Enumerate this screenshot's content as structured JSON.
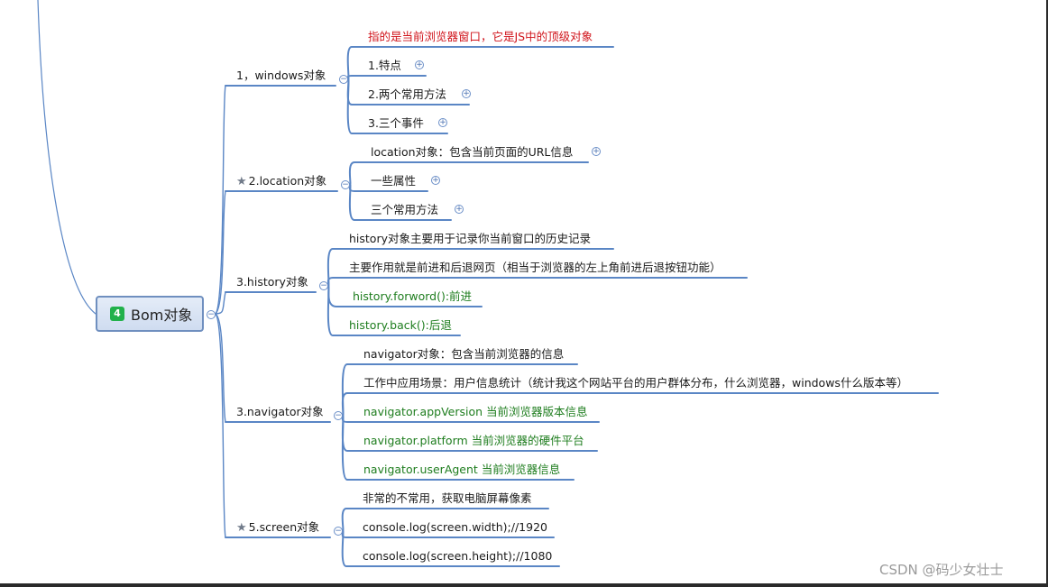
{
  "root": {
    "badge": "4",
    "label": "Bom对象"
  },
  "branches": [
    {
      "label": "1，windows对象",
      "starred": false,
      "toggle": "−",
      "children": [
        {
          "text": "指的是当前浏览器窗口，它是JS中的顶级对象",
          "color": "red",
          "toggle": ""
        },
        {
          "text": "1.特点",
          "color": "black",
          "toggle": "+"
        },
        {
          "text": "2.两个常用方法",
          "color": "black",
          "toggle": "+"
        },
        {
          "text": "3.三个事件",
          "color": "black",
          "toggle": "+"
        }
      ]
    },
    {
      "label": "2.location对象",
      "starred": true,
      "toggle": "−",
      "children": [
        {
          "text": "location对象：包含当前页面的URL信息",
          "color": "black",
          "toggle": "+"
        },
        {
          "text": "一些属性",
          "color": "black",
          "toggle": "+"
        },
        {
          "text": "三个常用方法",
          "color": "black",
          "toggle": "+"
        }
      ]
    },
    {
      "label": "3.history对象",
      "starred": false,
      "toggle": "−",
      "children": [
        {
          "text": "history对象主要用于记录你当前窗口的历史记录",
          "color": "black",
          "toggle": ""
        },
        {
          "text": "主要作用就是前进和后退网页（相当于浏览器的左上角前进后退按钮功能）",
          "color": "black",
          "toggle": ""
        },
        {
          "text": "history.forword():前进",
          "color": "green",
          "toggle": ""
        },
        {
          "text": "history.back():后退",
          "color": "green",
          "toggle": ""
        }
      ]
    },
    {
      "label": "3.navigator对象",
      "starred": false,
      "toggle": "−",
      "children": [
        {
          "text": "navigator对象：包含当前浏览器的信息",
          "color": "black",
          "toggle": ""
        },
        {
          "text": "工作中应用场景：用户信息统计（统计我这个网站平台的用户群体分布，什么浏览器，windows什么版本等）",
          "color": "black",
          "toggle": ""
        },
        {
          "text": "navigator.appVersion 当前浏览器版本信息",
          "color": "green",
          "toggle": ""
        },
        {
          "text": "navigator.platform 当前浏览器的硬件平台",
          "color": "green",
          "toggle": ""
        },
        {
          "text": "navigator.userAgent 当前浏览器信息",
          "color": "green",
          "toggle": ""
        }
      ]
    },
    {
      "label": "5.screen对象",
      "starred": true,
      "toggle": "−",
      "children": [
        {
          "text": "非常的不常用，获取电脑屏幕像素",
          "color": "black",
          "toggle": ""
        },
        {
          "text": "console.log(screen.width);//1920",
          "color": "black",
          "toggle": ""
        },
        {
          "text": "console.log(screen.height);//1080",
          "color": "black",
          "toggle": ""
        }
      ]
    }
  ],
  "watermark": "CSDN @码少女壮士",
  "colors": {
    "connector": "#5a86c5",
    "root_border": "#6f8fbf",
    "badge": "#21b14b",
    "red_text": "#d0141b",
    "green_text": "#1e7d1e"
  }
}
